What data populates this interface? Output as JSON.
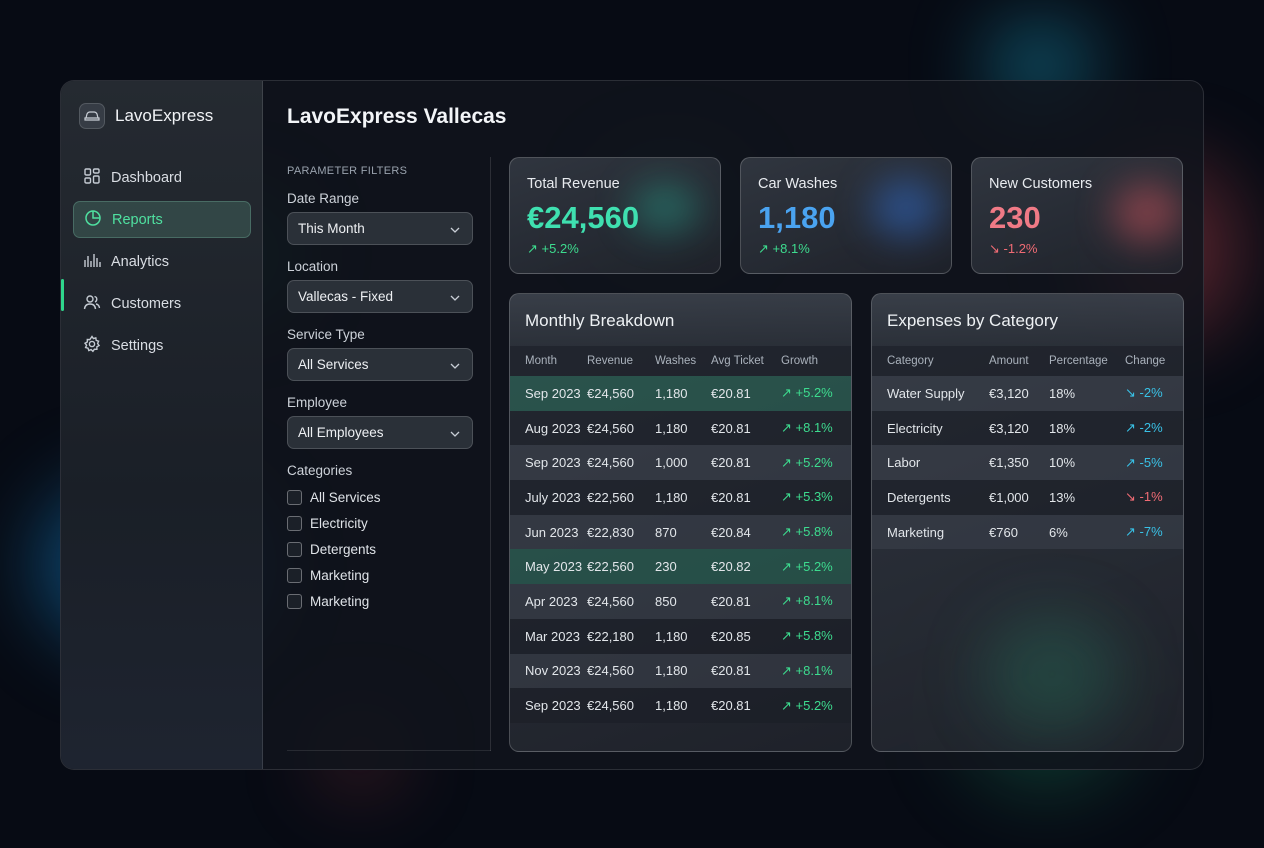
{
  "app": {
    "name": "LavoExpress"
  },
  "sidebar": {
    "items": [
      {
        "label": "Dashboard",
        "icon": "grid-icon",
        "active": false
      },
      {
        "label": "Reports",
        "icon": "pie-chart-icon",
        "active": true
      },
      {
        "label": "Analytics",
        "icon": "bar-chart-icon",
        "active": false
      },
      {
        "label": "Customers",
        "icon": "users-icon",
        "active": false
      },
      {
        "label": "Settings",
        "icon": "gear-icon",
        "active": false
      }
    ]
  },
  "page": {
    "title": "LavoExpress Vallecas"
  },
  "filters": {
    "heading": "PARAMETER FILTERS",
    "date_range": {
      "label": "Date Range",
      "value": "This Month"
    },
    "location": {
      "label": "Location",
      "value": "Vallecas - Fixed"
    },
    "service_type": {
      "label": "Service Type",
      "value": "All Services"
    },
    "employee": {
      "label": "Employee",
      "value": "All Employees"
    },
    "categories": {
      "label": "Categories",
      "options": [
        "All Services",
        "Electricity",
        "Detergents",
        "Marketing",
        "Marketing"
      ]
    }
  },
  "kpis": [
    {
      "label": "Total Revenue",
      "value": "€24,560",
      "change": "+5.2%",
      "trend": "up",
      "color": "#3fe0b0"
    },
    {
      "label": "Car Washes",
      "value": "1,180",
      "change": "+8.1%",
      "trend": "up",
      "color": "#4aa3f0"
    },
    {
      "label": "New Customers",
      "value": "230",
      "change": "-1.2%",
      "trend": "down",
      "color": "#f07a86"
    }
  ],
  "monthly": {
    "title": "Monthly Breakdown",
    "columns": [
      "Month",
      "Revenue",
      "Washes",
      "Avg Ticket",
      "Growth"
    ],
    "rows": [
      [
        "Sep 2023",
        "€24,560",
        "1,180",
        "€20.81",
        "+5.2%"
      ],
      [
        "Aug 2023",
        "€24,560",
        "1,180",
        "€20.81",
        "+8.1%"
      ],
      [
        "Sep 2023",
        "€24,560",
        "1,000",
        "€20.81",
        "+5.2%"
      ],
      [
        "July 2023",
        "€22,560",
        "1,180",
        "€20.81",
        "+5.3%"
      ],
      [
        "Jun 2023",
        "€22,830",
        "870",
        "€20.84",
        "+5.8%"
      ],
      [
        "May 2023",
        "€22,560",
        "230",
        "€20.82",
        "+5.2%"
      ],
      [
        "Apr 2023",
        "€24,560",
        "850",
        "€20.81",
        "+8.1%"
      ],
      [
        "Mar 2023",
        "€22,180",
        "1,180",
        "€20.85",
        "+5.8%"
      ],
      [
        "Nov 2023",
        "€24,560",
        "1,180",
        "€20.81",
        "+8.1%"
      ],
      [
        "Sep 2023",
        "€24,560",
        "1,180",
        "€20.81",
        "+5.2%"
      ]
    ],
    "highlighted_rows": [
      0,
      5
    ]
  },
  "expenses": {
    "title": "Expenses by Category",
    "columns": [
      "Category",
      "Amount",
      "Percentage",
      "Change"
    ],
    "rows": [
      {
        "cells": [
          "Water Supply",
          "€3,120",
          "18%",
          "-2%"
        ],
        "trend": "down-blue"
      },
      {
        "cells": [
          "Electricity",
          "€3,120",
          "18%",
          "-2%"
        ],
        "trend": "up-blue"
      },
      {
        "cells": [
          "Labor",
          "€1,350",
          "10%",
          "-5%"
        ],
        "trend": "up-blue"
      },
      {
        "cells": [
          "Detergents",
          "€1,000",
          "13%",
          "-1%"
        ],
        "trend": "down-red"
      },
      {
        "cells": [
          "Marketing",
          "€760",
          "6%",
          "-7%"
        ],
        "trend": "up-blue"
      }
    ]
  }
}
